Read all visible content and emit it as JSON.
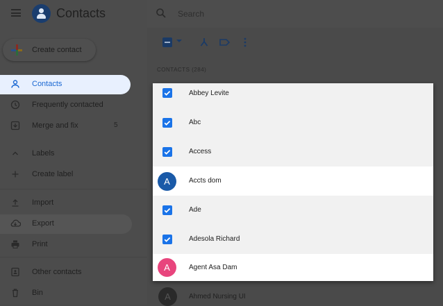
{
  "app": {
    "title": "Contacts"
  },
  "create_button": {
    "label": "Create contact"
  },
  "search": {
    "placeholder": "Search"
  },
  "nav": {
    "contacts": "Contacts",
    "frequent": "Frequently contacted",
    "merge": "Merge and fix",
    "merge_count": "5",
    "labels": "Labels",
    "create_label": "Create label",
    "import": "Import",
    "export": "Export",
    "print": "Print",
    "other": "Other contacts",
    "bin": "Bin"
  },
  "section_label": "CONTACTS (284)",
  "contacts": [
    {
      "name": "Abbey Levite",
      "state": "checked"
    },
    {
      "name": "Abc",
      "state": "checked"
    },
    {
      "name": "Access",
      "state": "checked"
    },
    {
      "name": "Accts dom",
      "state": "avatar",
      "initial": "A",
      "color": "#1a5aa8"
    },
    {
      "name": "Ade",
      "state": "checked"
    },
    {
      "name": "Adesola Richard",
      "state": "checked"
    },
    {
      "name": "Agent Asa Dam",
      "state": "avatar",
      "initial": "A",
      "color": "#e8457d"
    }
  ],
  "below_contact": {
    "name": "Ahmed Nursing UI",
    "initial": "A"
  },
  "colors": {
    "accent": "#1a73e8",
    "active_nav_bg": "#e8f0fe",
    "overlay": "#4a4a4a"
  }
}
